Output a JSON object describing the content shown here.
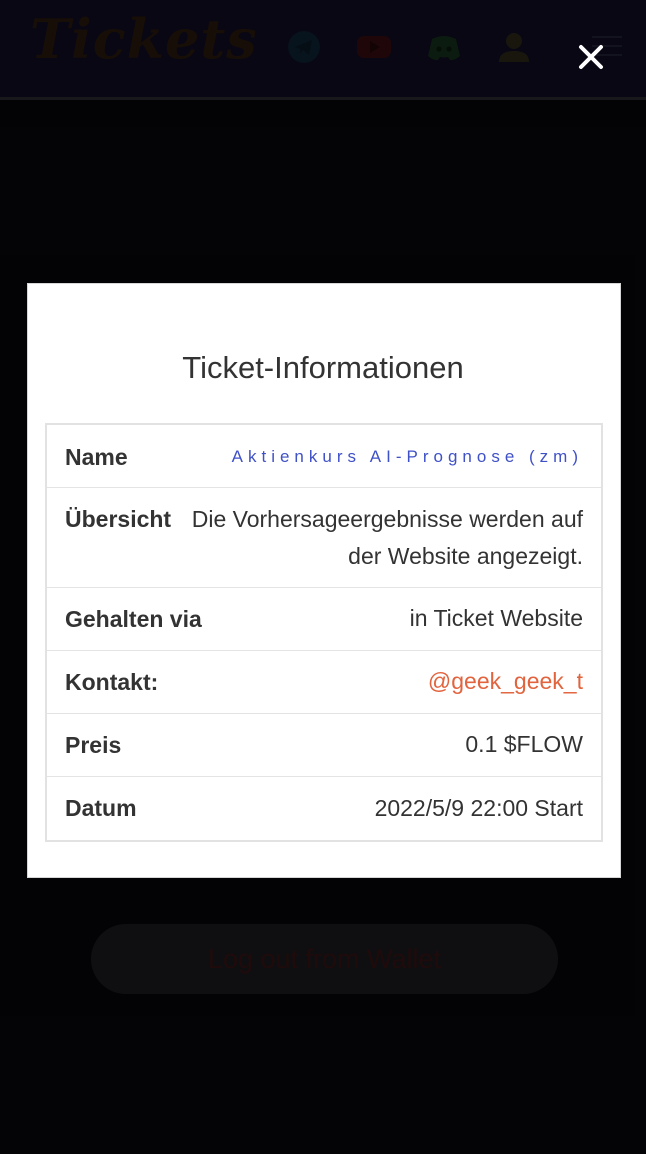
{
  "header": {
    "logo_text": "Tickets",
    "icons": [
      "telegram-icon",
      "youtube-icon",
      "discord-icon",
      "user-icon",
      "menu-icon"
    ]
  },
  "page": {
    "logout_label": "Log out from Wallet"
  },
  "modal": {
    "close_symbol": "✕",
    "title": "Ticket-Informationen",
    "rows": [
      {
        "label": "Name",
        "value": "Aktienkurs AI-Prognose (zm)"
      },
      {
        "label": "Übersicht",
        "value": "Die Vorhersageergebnisse werden auf der Website angezeigt."
      },
      {
        "label": "Gehalten via",
        "value": "in Ticket Website"
      },
      {
        "label": "Kontakt:",
        "value": "@geek_geek_t"
      },
      {
        "label": "Preis",
        "value": "0.1 $FLOW"
      },
      {
        "label": "Datum",
        "value": "2022/5/9 22:00 Start"
      }
    ]
  },
  "colors": {
    "name_value": "#3f51c7",
    "contact_link": "#e2643e",
    "header_bg": "#0f0d24"
  }
}
